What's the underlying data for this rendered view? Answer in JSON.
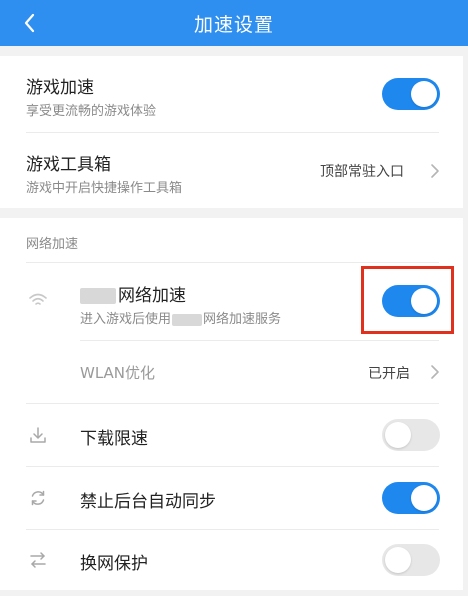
{
  "header": {
    "title": "加速设置"
  },
  "top": [
    {
      "title": "游戏加速",
      "subtitle": "享受更流畅的游戏体验",
      "toggle": "on"
    },
    {
      "title": "游戏工具箱",
      "subtitle": "游戏中开启快捷操作工具箱",
      "value": "顶部常驻入口"
    }
  ],
  "network": {
    "section_label": "网络加速",
    "accel": {
      "title": "网络加速",
      "sub_prefix": "进入游戏后使用",
      "sub_suffix": "网络加速服务",
      "toggle": "on"
    },
    "wlan": {
      "title": "WLAN优化",
      "value": "已开启"
    },
    "items": [
      {
        "title": "下载限速",
        "icon": "download-icon",
        "toggle": "off"
      },
      {
        "title": "禁止后台自动同步",
        "icon": "sync-icon",
        "toggle": "on"
      },
      {
        "title": "换网保护",
        "icon": "swap-icon",
        "toggle": "off"
      }
    ]
  },
  "colors": {
    "accent": "#1e88ef",
    "header": "#2f8ff0",
    "highlight": "#e0301e"
  }
}
